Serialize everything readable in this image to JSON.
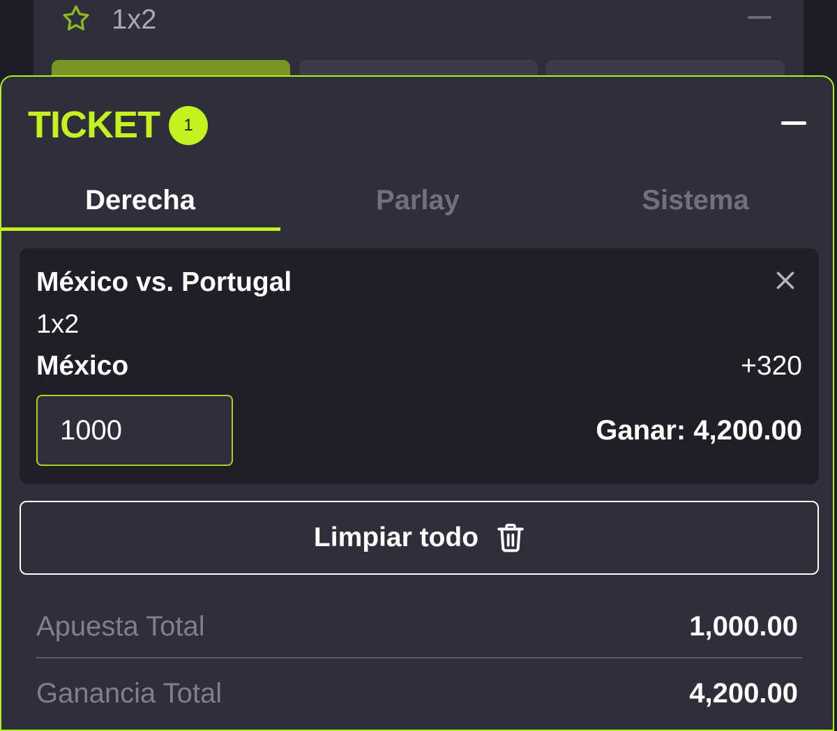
{
  "market_section": {
    "title": "1x2"
  },
  "ticket": {
    "title": "TICKET",
    "count": "1",
    "tabs": [
      {
        "label": "Derecha",
        "active": true
      },
      {
        "label": "Parlay",
        "active": false
      },
      {
        "label": "Sistema",
        "active": false
      }
    ],
    "bet": {
      "match": "México vs. Portugal",
      "market": "1x2",
      "selection": "México",
      "odds": "+320",
      "stake": "1000",
      "win_label": "Ganar: 4,200.00"
    },
    "clear_label": "Limpiar todo",
    "totals": {
      "stake_label": "Apuesta Total",
      "stake_value": "1,000.00",
      "win_label": "Ganancia Total",
      "win_value": "4,200.00"
    }
  },
  "colors": {
    "accent": "#c4f21f",
    "background": "#1d1d26",
    "panel": "#2f2f3c",
    "bet_card": "#1f1f28"
  },
  "icons": [
    "star-icon",
    "minus-icon",
    "close-icon",
    "trash-icon"
  ]
}
